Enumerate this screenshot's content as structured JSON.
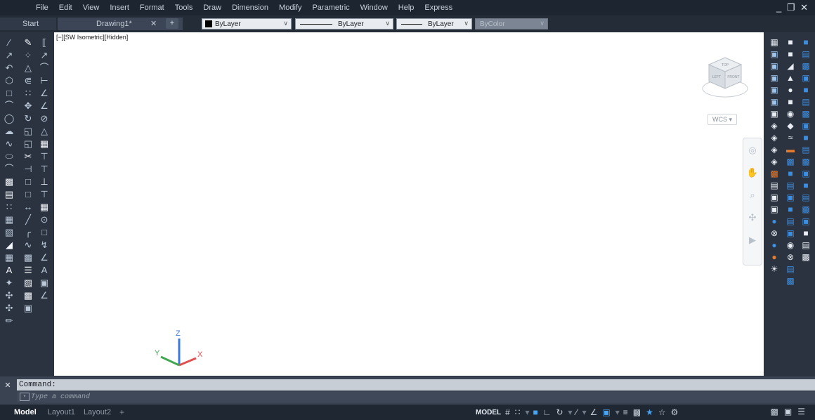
{
  "menubar": {
    "items": [
      "File",
      "Edit",
      "View",
      "Insert",
      "Format",
      "Tools",
      "Draw",
      "Dimension",
      "Modify",
      "Parametric",
      "Window",
      "Help",
      "Express"
    ],
    "window_controls": "_ ❐ ✕"
  },
  "tabs": {
    "start_label": "Start",
    "drawing_label": "Drawing1*",
    "close_glyph": "✕",
    "new_tab_glyph": "+"
  },
  "properties": {
    "color_value": "ByLayer",
    "linetype_value": "ByLayer",
    "lineweight_value": "ByLayer",
    "plotstyle_value": "ByColor"
  },
  "viewport": {
    "label": "[−][SW Isometric][Hidden]",
    "wcs_label": "WCS ▾",
    "viewcube_faces": [
      "TOP",
      "LEFT",
      "FRONT"
    ]
  },
  "ucs": {
    "x": "X",
    "y": "Y",
    "z": "Z"
  },
  "command": {
    "history_text": "Command:",
    "placeholder": "Type a command",
    "close_glyph": "✕"
  },
  "layout_tabs": [
    "Model",
    "Layout1",
    "Layout2"
  ],
  "layout_add": "+",
  "status": {
    "model_label": "MODEL"
  },
  "colors": {
    "background": "#2b3341",
    "menubar": "#1d2531",
    "canvas": "#ffffff",
    "accent": "#49a5f2",
    "ucs_x": "#e05050",
    "ucs_y": "#3fa850",
    "ucs_z": "#3a7ae0"
  },
  "icons": {
    "left_toolbar": [
      "line-icon",
      "polyline-icon",
      "arc-icon",
      "circle-icon",
      "rectangle-icon",
      "ellipse-icon",
      "hatch-icon",
      "region-icon",
      "table-icon",
      "text-icon",
      "block-icon",
      "point-icon",
      "spline-icon",
      "move-icon",
      "copy-icon",
      "rotate-icon",
      "mirror-icon",
      "offset-icon",
      "trim-icon",
      "extend-icon",
      "fillet-icon",
      "chamfer-icon",
      "explode-icon",
      "dimension-icon"
    ],
    "right_toolbar": [
      "box-icon",
      "sphere-icon",
      "cone-icon",
      "cylinder-icon",
      "wedge-icon",
      "torus-icon",
      "extrude-icon",
      "revolve-icon",
      "sweep-icon",
      "loft-icon",
      "union-icon",
      "subtract-icon",
      "intersect-icon",
      "slice-icon",
      "section-icon",
      "render-icon",
      "material-icon",
      "light-icon",
      "camera-icon",
      "visual-style-icon"
    ]
  }
}
